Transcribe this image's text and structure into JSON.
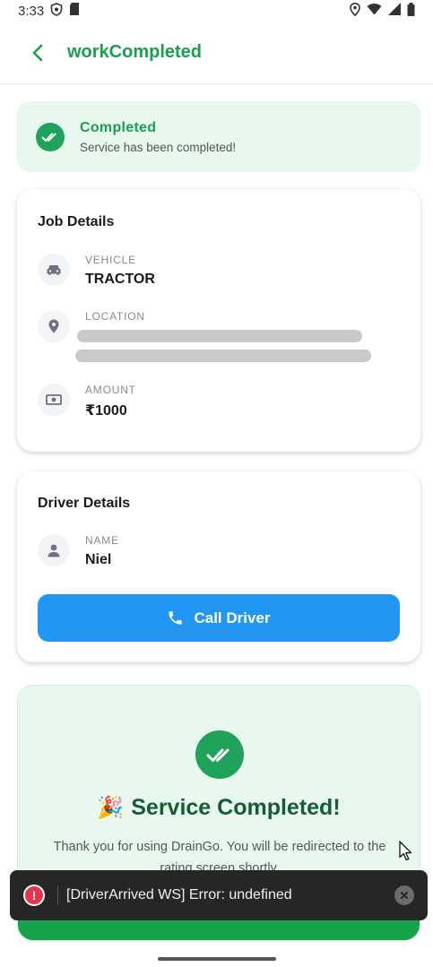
{
  "status_bar": {
    "time": "3:33",
    "left_icons": [
      "shield-icon",
      "sd-card-icon"
    ],
    "right_icons": [
      "location-icon",
      "wifi-icon",
      "signal-icon",
      "battery-icon"
    ]
  },
  "header": {
    "back_icon": "chevron-left-icon",
    "title": "workCompleted"
  },
  "banner": {
    "title": "Completed",
    "subtitle": "Service has been completed!",
    "icon": "double-check-icon"
  },
  "job_details": {
    "title": "Job Details",
    "vehicle": {
      "label": "VEHICLE",
      "value": "TRACTOR",
      "icon": "car-icon"
    },
    "location": {
      "label": "LOCATION",
      "icon": "location-pin-icon"
    },
    "amount": {
      "label": "AMOUNT",
      "value": "₹1000",
      "icon": "cash-icon"
    }
  },
  "driver_details": {
    "title": "Driver Details",
    "name": {
      "label": "NAME",
      "value": "Niel",
      "icon": "person-icon"
    },
    "call_button": "Call Driver"
  },
  "completion": {
    "emoji": "🎉",
    "title": "Service Completed!",
    "message": "Thank you for using DrainGo. You will be redirected to the rating screen shortly."
  },
  "toast": {
    "message": "[DriverArrived WS] Error: undefined",
    "icon": "error-icon"
  },
  "colors": {
    "accent_green": "#1a9e4f",
    "banner_bg": "#e8f8ef",
    "call_blue": "#2196f3",
    "toast_bg": "#262626",
    "error_red": "#e8344a"
  }
}
